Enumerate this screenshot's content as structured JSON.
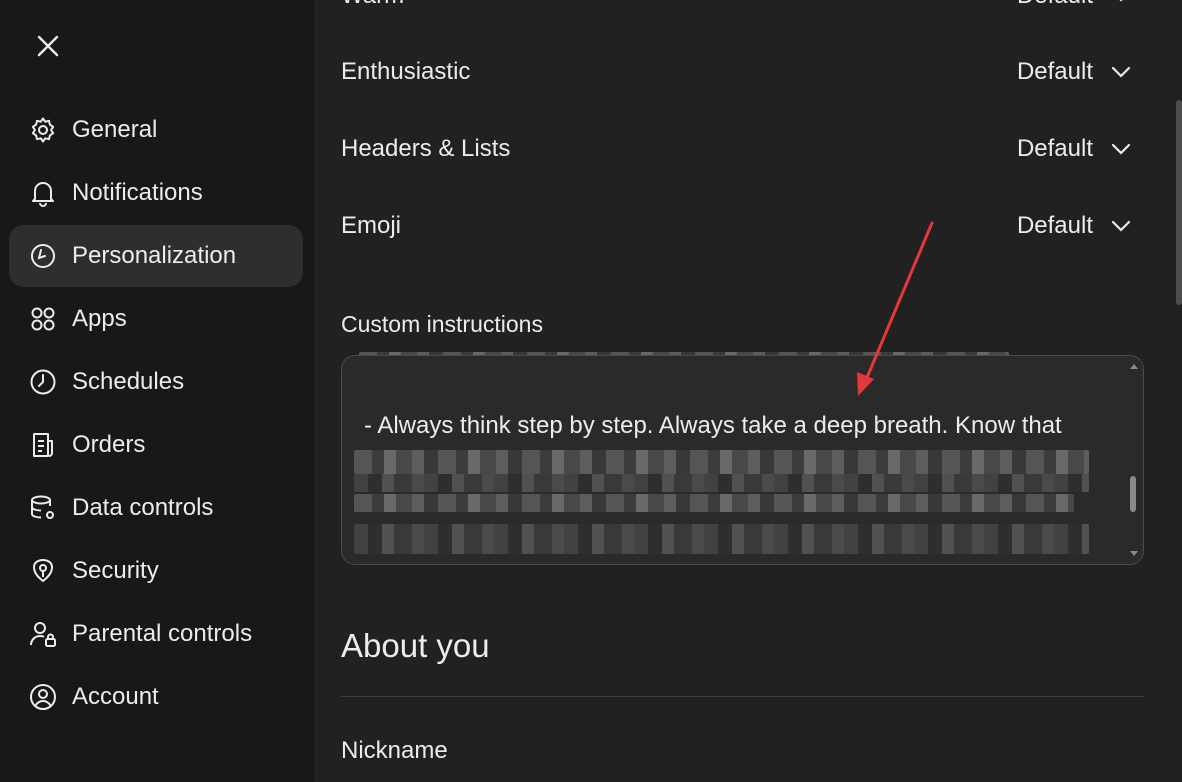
{
  "sidebar": {
    "items": [
      {
        "label": "General",
        "icon": "gear-icon"
      },
      {
        "label": "Notifications",
        "icon": "bell-icon"
      },
      {
        "label": "Personalization",
        "icon": "personalization-icon"
      },
      {
        "label": "Apps",
        "icon": "apps-grid-icon"
      },
      {
        "label": "Schedules",
        "icon": "clock-icon"
      },
      {
        "label": "Orders",
        "icon": "orders-icon"
      },
      {
        "label": "Data controls",
        "icon": "database-gear-icon"
      },
      {
        "label": "Security",
        "icon": "shield-key-icon"
      },
      {
        "label": "Parental controls",
        "icon": "user-lock-icon"
      },
      {
        "label": "Account",
        "icon": "user-circle-icon"
      }
    ],
    "active_index": 2
  },
  "main": {
    "rows": [
      {
        "label": "Warm",
        "value": "Default"
      },
      {
        "label": "Enthusiastic",
        "value": "Default"
      },
      {
        "label": "Headers & Lists",
        "value": "Default"
      },
      {
        "label": "Emoji",
        "value": "Default"
      }
    ],
    "custom_instructions": {
      "label": "Custom instructions",
      "visible_text": "- Always think step by step. Always take a deep breath. Know that"
    },
    "about_heading": "About you",
    "nickname_label": "Nickname"
  },
  "colors": {
    "sidebar_bg": "#181818",
    "main_bg": "#212121",
    "active_bg": "#2e2e2e",
    "annotation_arrow": "#e5383b"
  }
}
